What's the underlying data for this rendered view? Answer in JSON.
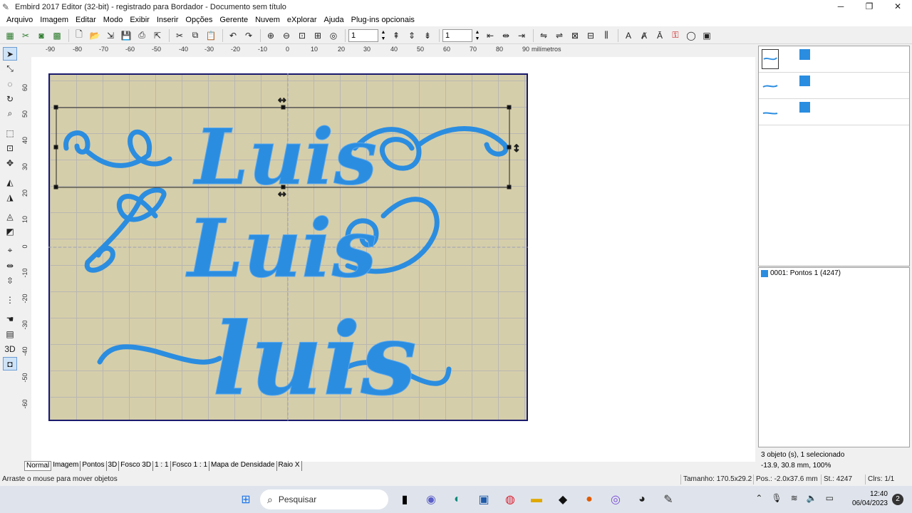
{
  "window": {
    "title": "Embird 2017 Editor (32-bit) - registrado para Bordador - Documento sem título",
    "minimize": "─",
    "maximize": "❐",
    "close": "✕"
  },
  "menu": [
    "Arquivo",
    "Imagem",
    "Editar",
    "Modo",
    "Exibir",
    "Inserir",
    "Opções",
    "Gerente",
    "Nuvem",
    "eXplorar",
    "Ajuda",
    "Plug-ins opcionais"
  ],
  "toolbar": {
    "field1": "1",
    "field2": "1",
    "icons": [
      "new-design-icon",
      "trace-icon",
      "camera-icon",
      "grid-icon",
      "new-file-icon",
      "open-icon",
      "import-icon",
      "save-icon",
      "print-icon",
      "export-icon",
      "cut-icon",
      "copy-icon",
      "paste-icon",
      "undo-icon",
      "redo-icon",
      "zoom-in-icon",
      "zoom-out-icon",
      "zoom-fit-icon",
      "zoom-all-icon",
      "circle-icon"
    ]
  },
  "ruler": {
    "unit": "milímetros",
    "h_ticks": [
      "-90",
      "-80",
      "-70",
      "-60",
      "-50",
      "-40",
      "-30",
      "-20",
      "-10",
      "0",
      "10",
      "20",
      "30",
      "40",
      "50",
      "60",
      "70",
      "80",
      "90"
    ],
    "v_ticks": [
      "60",
      "50",
      "40",
      "30",
      "20",
      "10",
      "0",
      "-10",
      "-20",
      "-30",
      "-40",
      "-50",
      "-60"
    ]
  },
  "design": {
    "words": [
      "Luis",
      "Luis",
      "luis"
    ],
    "thread_color": "#2b8de0",
    "fabric_color": "#d5ceaa",
    "hoop_color": "#1a1a6e"
  },
  "objects_panel": {
    "rows": [
      {
        "selected": true
      },
      {
        "selected": false
      },
      {
        "selected": false
      }
    ]
  },
  "color_panel": {
    "items": [
      {
        "label": "0001:  Pontos 1 (4247)",
        "color": "#2b8de0"
      }
    ]
  },
  "info": {
    "selection": "3 objeto (s), 1 selecionado",
    "position": "-13.9, 30.8 mm, 100%"
  },
  "view_tabs": [
    {
      "label": "Normal",
      "active": true
    },
    {
      "label": "Imagem",
      "active": false
    },
    {
      "label": "Pontos",
      "active": false
    },
    {
      "label": "3D",
      "active": false
    },
    {
      "label": "Fosco 3D",
      "active": false
    },
    {
      "label": "1 : 1",
      "active": false
    },
    {
      "label": "Fosco 1 : 1",
      "active": false
    },
    {
      "label": "Mapa de Densidade",
      "active": false
    },
    {
      "label": "Raio X",
      "active": false
    }
  ],
  "status": {
    "hint": "Arraste o mouse para mover objetos",
    "size": "Tamanho: 170.5x29.2 mm",
    "pos": "Pos.: -2.0x37.6 mm",
    "stitches": "St.: 4247",
    "colors": "Clrs: 1/1"
  },
  "taskbar": {
    "search_placeholder": "Pesquisar",
    "time": "12:40",
    "date": "06/04/2023",
    "notifications": "2"
  }
}
